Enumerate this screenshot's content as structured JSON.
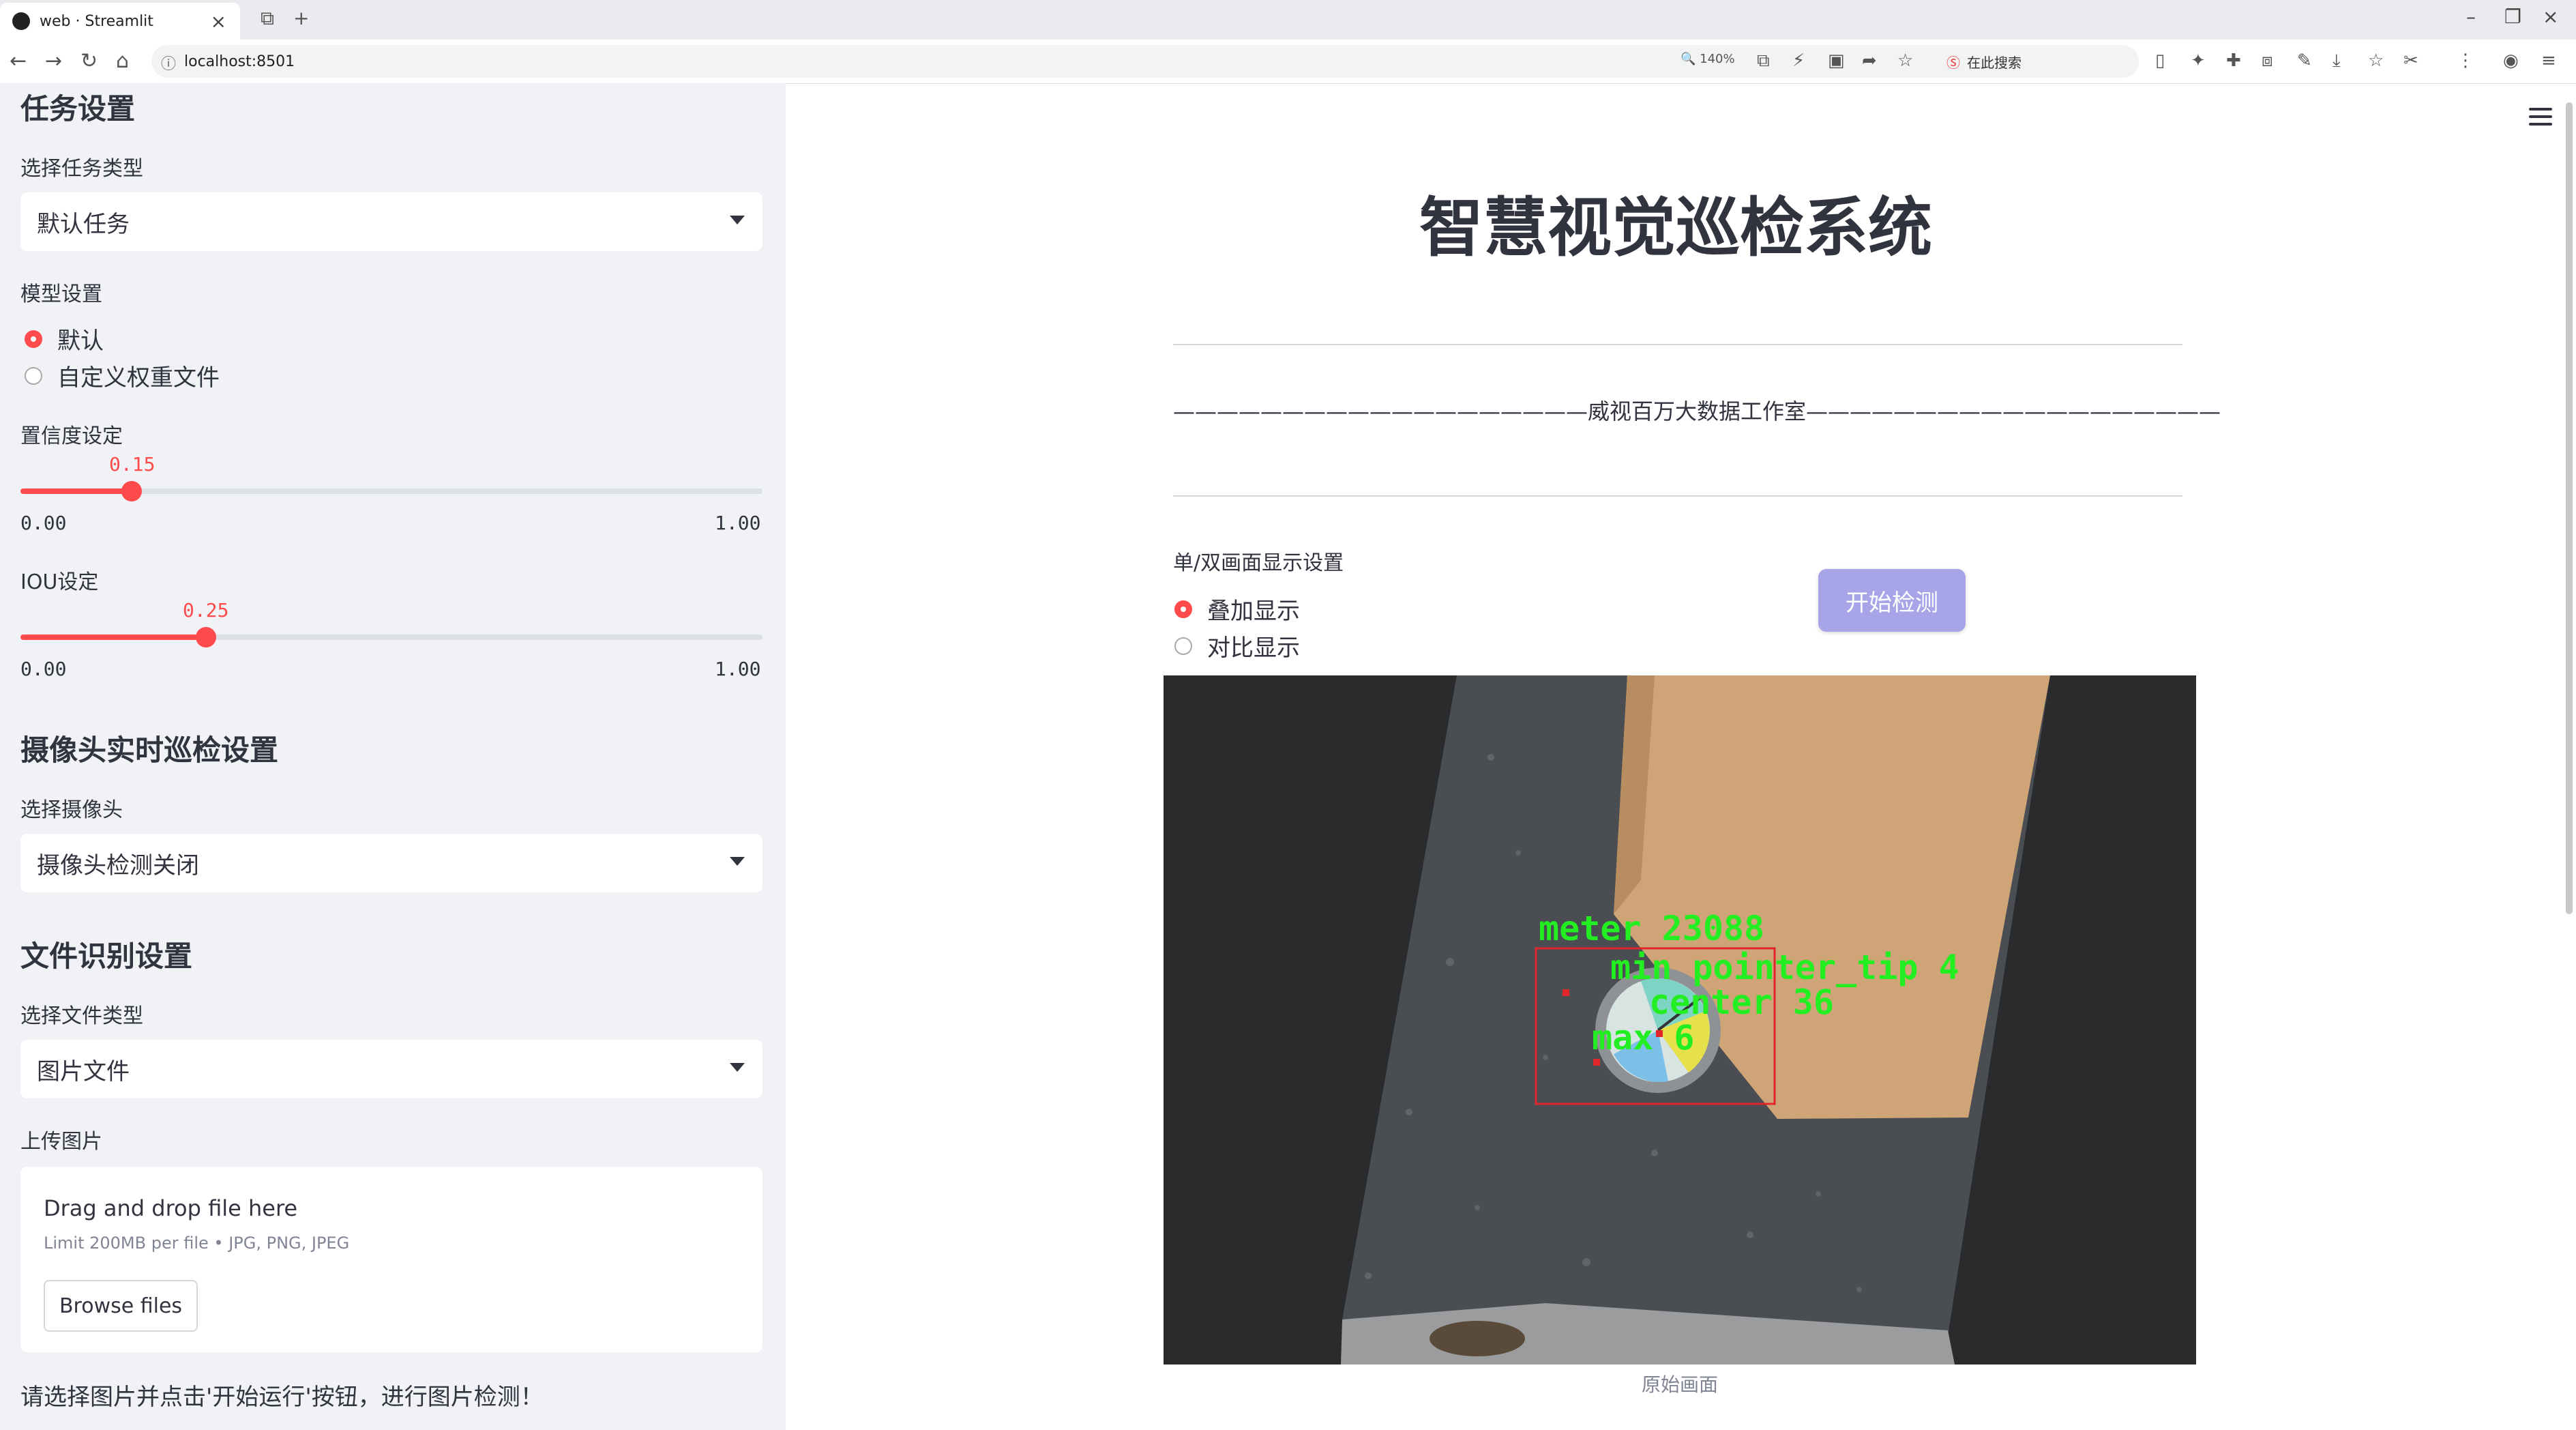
{
  "browser": {
    "tab_title": "web · Streamlit",
    "url": "localhost:8501",
    "zoom": "140%",
    "search_placeholder": "在此搜索"
  },
  "sidebar": {
    "task_section": {
      "title": "任务设置",
      "select_label": "选择任务类型",
      "select_value": "默认任务"
    },
    "model_section": {
      "label": "模型设置",
      "options": [
        "默认",
        "自定义权重文件"
      ],
      "selected": 0
    },
    "confidence": {
      "label": "置信度设定",
      "value": "0.15",
      "min": "0.00",
      "max": "1.00",
      "fraction": 0.15
    },
    "iou": {
      "label": "IOU设定",
      "value": "0.25",
      "min": "0.00",
      "max": "1.00",
      "fraction": 0.25
    },
    "camera_section": {
      "title": "摄像头实时巡检设置",
      "select_label": "选择摄像头",
      "select_value": "摄像头检测关闭"
    },
    "file_section": {
      "title": "文件识别设置",
      "type_label": "选择文件类型",
      "type_value": "图片文件",
      "upload_label": "上传图片",
      "drop_text": "Drag and drop file here",
      "limit_text": "Limit 200MB per file • JPG, PNG, JPEG",
      "browse_label": "Browse files"
    },
    "hint": "请选择图片并点击'开始运行'按钮，进行图片检测！"
  },
  "main": {
    "title": "智慧视觉巡检系统",
    "subtitle": "———————————————————威视百万大数据工作室———————————————————",
    "display_label": "单/双画面显示设置",
    "display_options": [
      "叠加显示",
      "对比显示"
    ],
    "display_selected": 0,
    "start_button": "开始检测",
    "image_caption": "原始画面",
    "detections": [
      "meter 23088",
      "min pointer_tip 4",
      "center 36",
      "max 6"
    ]
  },
  "colors": {
    "accent": "#ff4b4b",
    "button": "#a8a4e8",
    "sidebar_bg": "#f0f2f6",
    "detection_text": "#22ee22",
    "box": "#e0262b"
  }
}
